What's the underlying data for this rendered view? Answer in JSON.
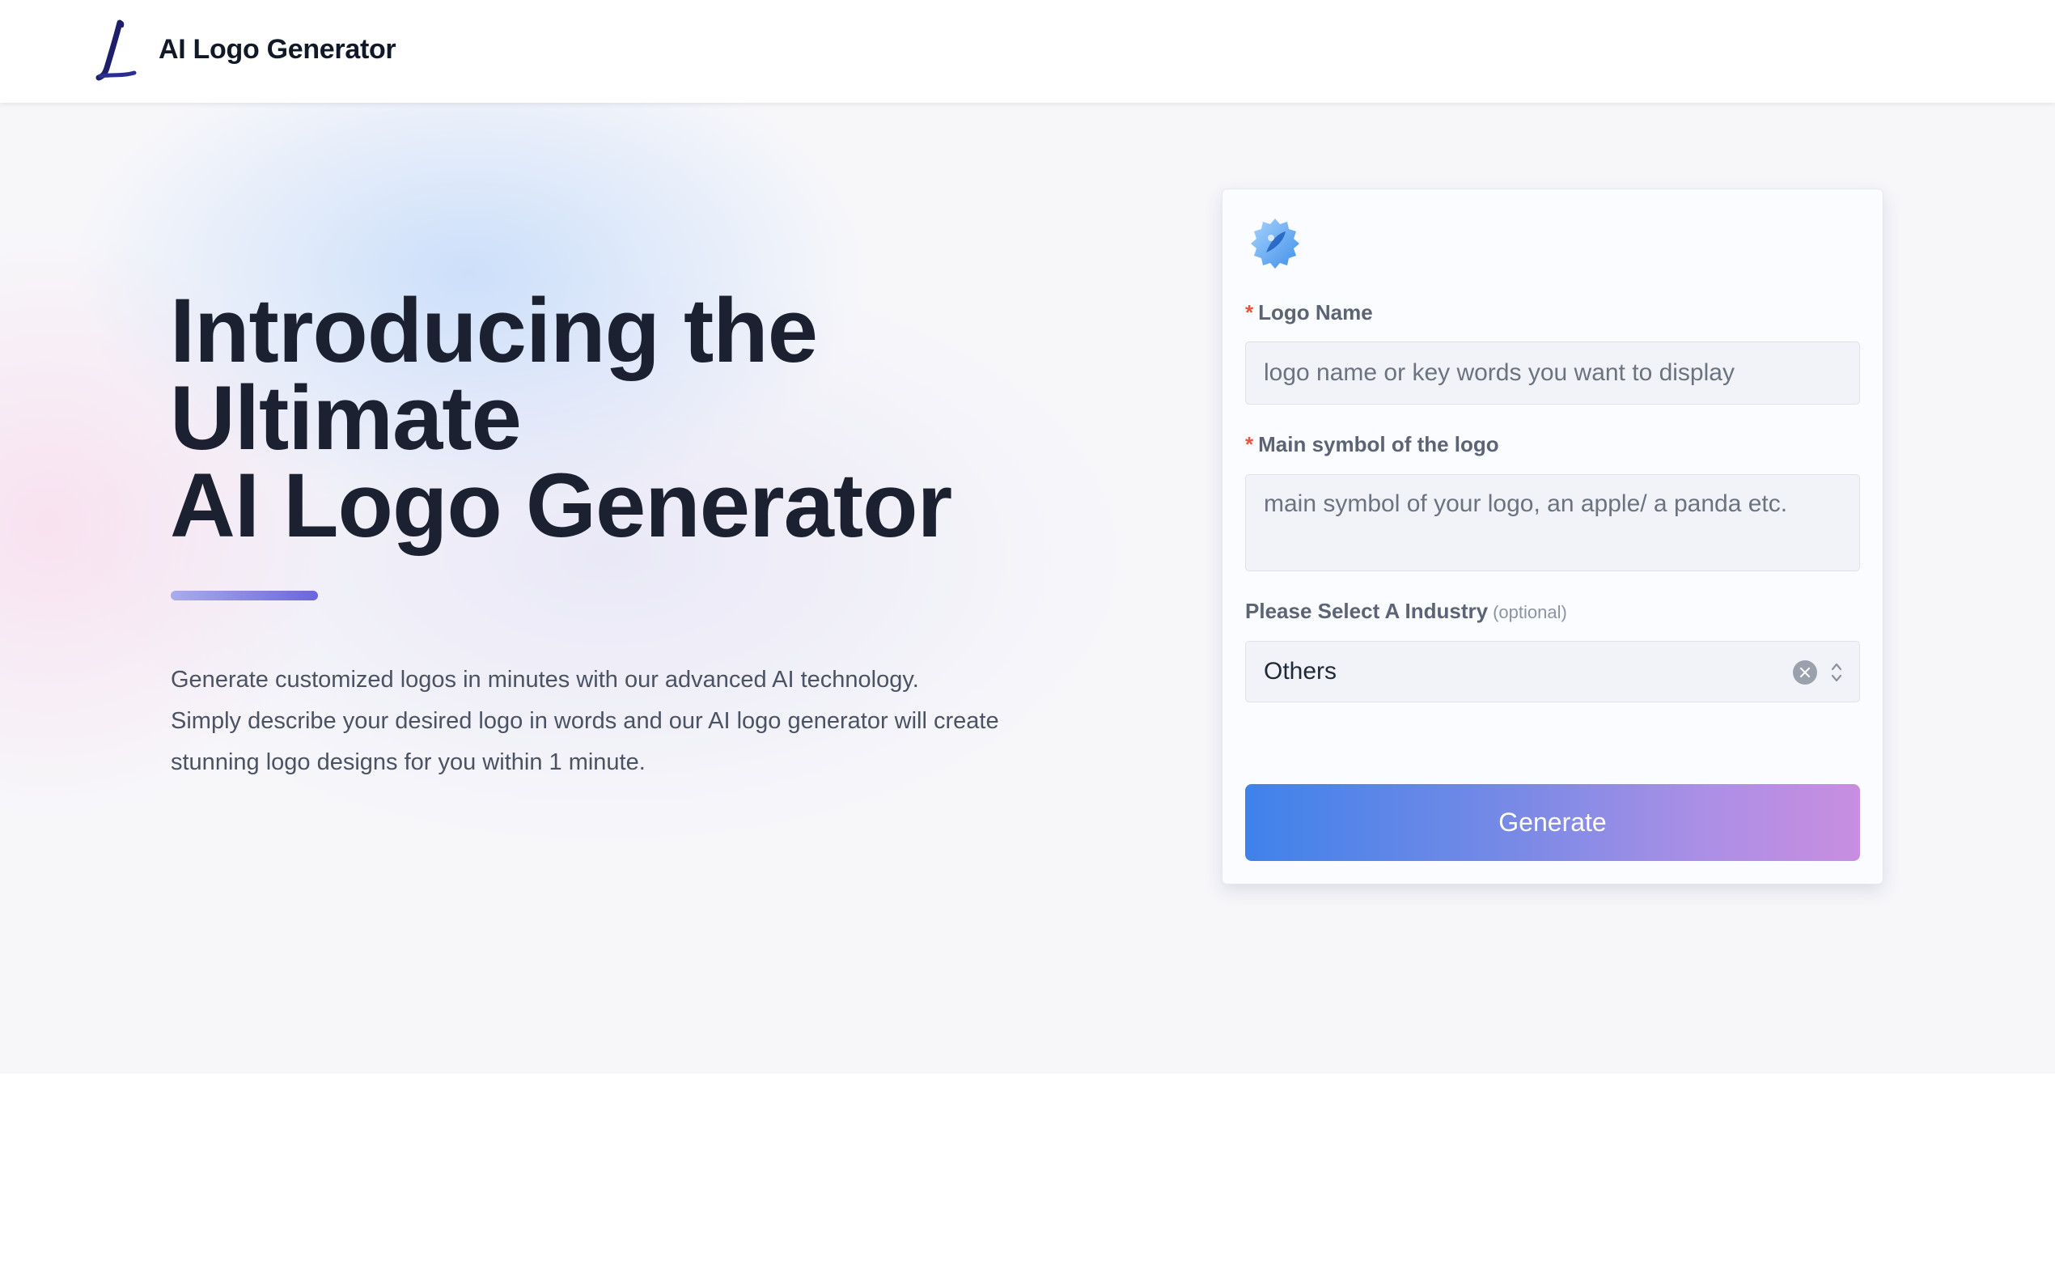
{
  "header": {
    "logo_icon": "script-letter-l-logo",
    "title": "AI Logo Generator"
  },
  "hero": {
    "headline_lines": [
      "Introducing the",
      "Ultimate",
      "AI Logo Generator"
    ],
    "description_lines": [
      "Generate customized logos in minutes with our advanced AI technology.",
      "Simply describe your desired logo in words and our AI logo generator will create",
      "stunning logo designs for you within 1 minute."
    ],
    "accent_gradient": [
      "#a9acea",
      "#6b66dc"
    ]
  },
  "form": {
    "card_icon": "gear-badge-icon",
    "logo_name": {
      "required_mark": "*",
      "label": "Logo Name",
      "placeholder": "logo name or key words you want to display",
      "value": ""
    },
    "main_symbol": {
      "required_mark": "*",
      "label": "Main symbol of the logo",
      "placeholder": "main symbol of your logo, an apple/ a panda etc.",
      "value": ""
    },
    "industry": {
      "label": "Please Select A Industry",
      "optional_hint": "(optional)",
      "selected": "Others"
    },
    "generate_label": "Generate"
  },
  "colors": {
    "required": "#e8553a",
    "button_gradient_start": "#3f82ea",
    "button_gradient_end": "#c88ee0",
    "headline": "#1b2130"
  }
}
